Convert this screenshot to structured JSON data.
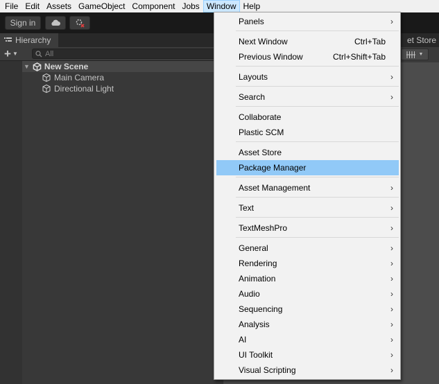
{
  "menubar": {
    "items": [
      "File",
      "Edit",
      "Assets",
      "GameObject",
      "Component",
      "Jobs",
      "Window",
      "Help"
    ],
    "active": "Window"
  },
  "toolbar": {
    "sign_in_label": "Sign in",
    "cloud_icon": "cloud-icon",
    "collab_icon": "collab-icon"
  },
  "hierarchy": {
    "tab_label": "Hierarchy",
    "search_placeholder": "All",
    "scene_name": "New Scene",
    "items": [
      "Main Camera",
      "Directional Light"
    ]
  },
  "scene_panel": {
    "store_tab_label": "et Store"
  },
  "window_menu": {
    "groups": [
      [
        {
          "label": "Panels",
          "submenu": true
        }
      ],
      [
        {
          "label": "Next Window",
          "shortcut": "Ctrl+Tab"
        },
        {
          "label": "Previous Window",
          "shortcut": "Ctrl+Shift+Tab"
        }
      ],
      [
        {
          "label": "Layouts",
          "submenu": true
        }
      ],
      [
        {
          "label": "Search",
          "submenu": true
        }
      ],
      [
        {
          "label": "Collaborate"
        },
        {
          "label": "Plastic SCM"
        }
      ],
      [
        {
          "label": "Asset Store"
        },
        {
          "label": "Package Manager",
          "highlighted": true
        }
      ],
      [
        {
          "label": "Asset Management",
          "submenu": true
        }
      ],
      [
        {
          "label": "Text",
          "submenu": true
        }
      ],
      [
        {
          "label": "TextMeshPro",
          "submenu": true
        }
      ],
      [
        {
          "label": "General",
          "submenu": true
        },
        {
          "label": "Rendering",
          "submenu": true
        },
        {
          "label": "Animation",
          "submenu": true
        },
        {
          "label": "Audio",
          "submenu": true
        },
        {
          "label": "Sequencing",
          "submenu": true
        },
        {
          "label": "Analysis",
          "submenu": true
        },
        {
          "label": "AI",
          "submenu": true
        },
        {
          "label": "UI Toolkit",
          "submenu": true
        },
        {
          "label": "Visual Scripting",
          "submenu": true
        }
      ]
    ]
  },
  "colors": {
    "menubar_bg": "#f0f0f0",
    "menu_bg": "#f2f2f2",
    "highlight": "#91c9f7",
    "editor_dark": "#383838"
  }
}
